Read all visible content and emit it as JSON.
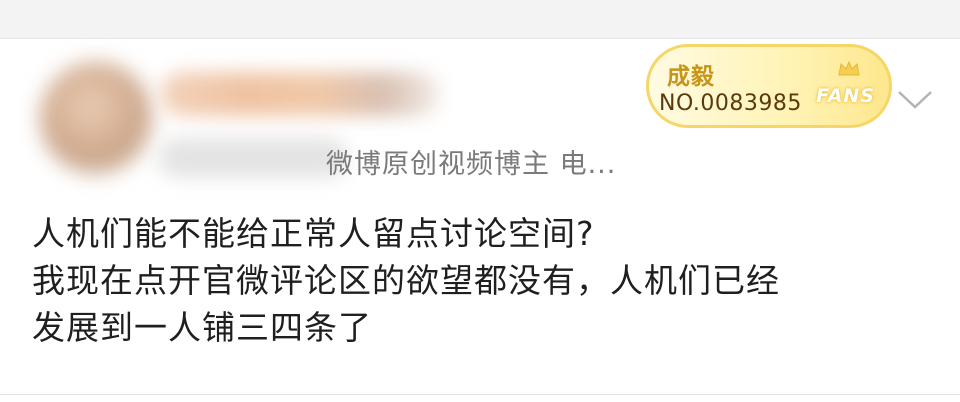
{
  "post": {
    "author": {
      "subtitle": "微博原创视频博主 电..."
    },
    "fan_badge": {
      "name": "成毅",
      "number": "NO.0083985",
      "label": "FANS"
    },
    "content_lines": [
      "人机们能不能给正常人留点讨论空间?",
      "我现在点开官微评论区的欲望都没有，人机们已经",
      "发展到一人铺三四条了"
    ]
  },
  "icons": {
    "badge_icon": "crown-icon",
    "menu_icon": "chevron-down-icon"
  },
  "colors": {
    "badge_gold": "#c79417",
    "badge_border": "#f7d668",
    "text_primary": "#1f1f1f",
    "text_secondary": "#7a7a7a"
  }
}
